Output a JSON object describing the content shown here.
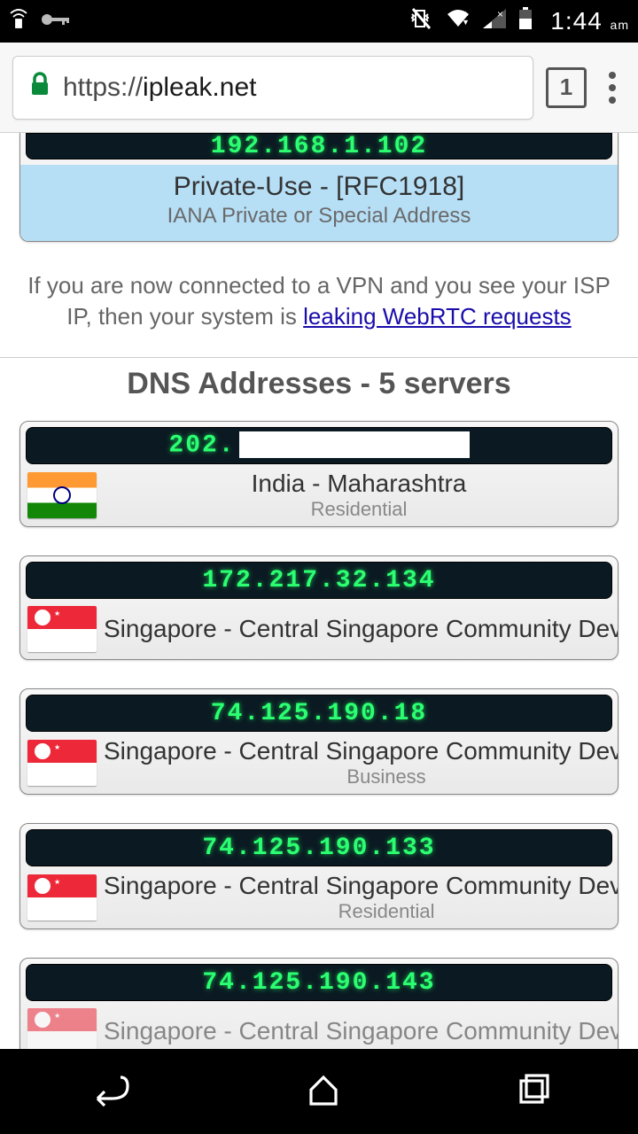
{
  "status": {
    "time": "1:44",
    "ampm": "am"
  },
  "browser": {
    "protocol": "https://",
    "host": "ipleak.net",
    "tab_count": "1"
  },
  "private_card": {
    "ip": "192.168.1.102",
    "line1": "Private-Use - [RFC1918]",
    "line2": "IANA Private or Special Address"
  },
  "vpn_warning": {
    "pre": "If you are now connected to a VPN and you see your ISP IP, then your system is ",
    "link": "leaking WebRTC requests"
  },
  "dns_heading": "DNS Addresses - 5 servers",
  "dns": [
    {
      "ip_prefix": "202.",
      "location": "India - Maharashtra",
      "type": "Residential",
      "flag": "india",
      "masked": true,
      "centered": true
    },
    {
      "ip": "172.217.32.134",
      "location": "Singapore - Central Singapore Community Develop",
      "type": "",
      "flag": "sg",
      "centered": false
    },
    {
      "ip": "74.125.190.18",
      "location": "Singapore - Central Singapore Community Develop",
      "type": "Business",
      "flag": "sg",
      "centered": false
    },
    {
      "ip": "74.125.190.133",
      "location": "Singapore - Central Singapore Community Develop",
      "type": "Residential",
      "flag": "sg",
      "centered": false
    },
    {
      "ip": "74.125.190.143",
      "location": "Singapore - Central Singapore Community Develop",
      "type": "",
      "flag": "sg",
      "centered": false
    }
  ]
}
